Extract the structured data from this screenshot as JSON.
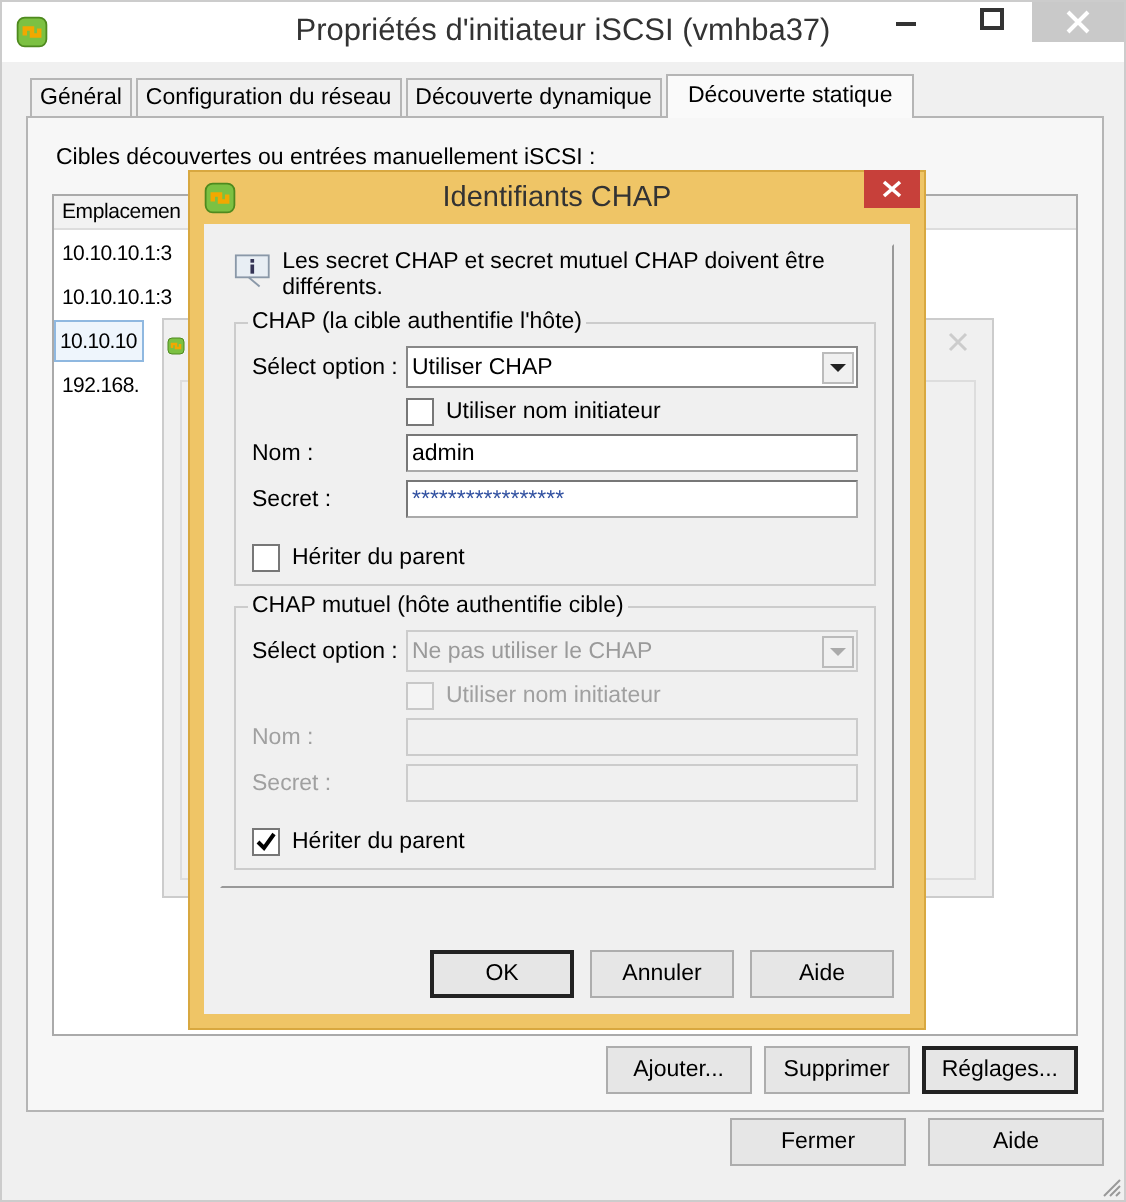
{
  "window": {
    "title": "Propriétés d'initiateur iSCSI (vmhba37)"
  },
  "tabs": [
    {
      "label": "Général",
      "selected": false
    },
    {
      "label": "Configuration du réseau",
      "selected": false
    },
    {
      "label": "Découverte dynamique",
      "selected": false
    },
    {
      "label": "Découverte statique",
      "selected": true
    }
  ],
  "targets_label": "Cibles découvertes ou entrées manuellement iSCSI :",
  "table": {
    "columns": [
      "Emplacemen"
    ],
    "rows": [
      {
        "cells": [
          "10.10.10.1:3"
        ],
        "selected": false
      },
      {
        "cells": [
          "10.10.10.1:3"
        ],
        "selected": false
      },
      {
        "cells": [
          "10.10.10"
        ],
        "selected": true
      },
      {
        "cells": [
          "192.168."
        ],
        "selected": false
      }
    ]
  },
  "panel_buttons": [
    {
      "label": "Ajouter...",
      "default": false
    },
    {
      "label": "Supprimer",
      "default": false
    },
    {
      "label": "Réglages...",
      "default": true
    }
  ],
  "footer_buttons": [
    {
      "label": "Fermer",
      "default": false
    },
    {
      "label": "Aide",
      "default": false
    }
  ],
  "chap_dialog": {
    "title": "Identifiants CHAP",
    "info": "Les secret CHAP et secret mutuel CHAP doivent être différents.",
    "groups": [
      {
        "legend": "CHAP (la cible authentifie l'hôte)",
        "disabled": false,
        "select_label": "Sélect option :",
        "select_value": "Utiliser CHAP",
        "use_initiator": {
          "label": "Utiliser nom initiateur",
          "checked": false
        },
        "name_label": "Nom :",
        "name_value": "admin",
        "secret_label": "Secret :",
        "secret_value": "*****************",
        "inherit": {
          "label": "Hériter du parent",
          "checked": false
        }
      },
      {
        "legend": "CHAP mutuel (hôte authentifie cible)",
        "disabled": true,
        "select_label": "Sélect option :",
        "select_value": "Ne pas utiliser le CHAP",
        "use_initiator": {
          "label": "Utiliser nom initiateur",
          "checked": false
        },
        "name_label": "Nom :",
        "secret_label": "Secret :",
        "inherit": {
          "label": "Hériter du parent",
          "checked": true
        }
      }
    ],
    "buttons": [
      {
        "label": "OK",
        "default": true
      },
      {
        "label": "Annuler",
        "default": false
      },
      {
        "label": "Aide",
        "default": false
      }
    ]
  }
}
